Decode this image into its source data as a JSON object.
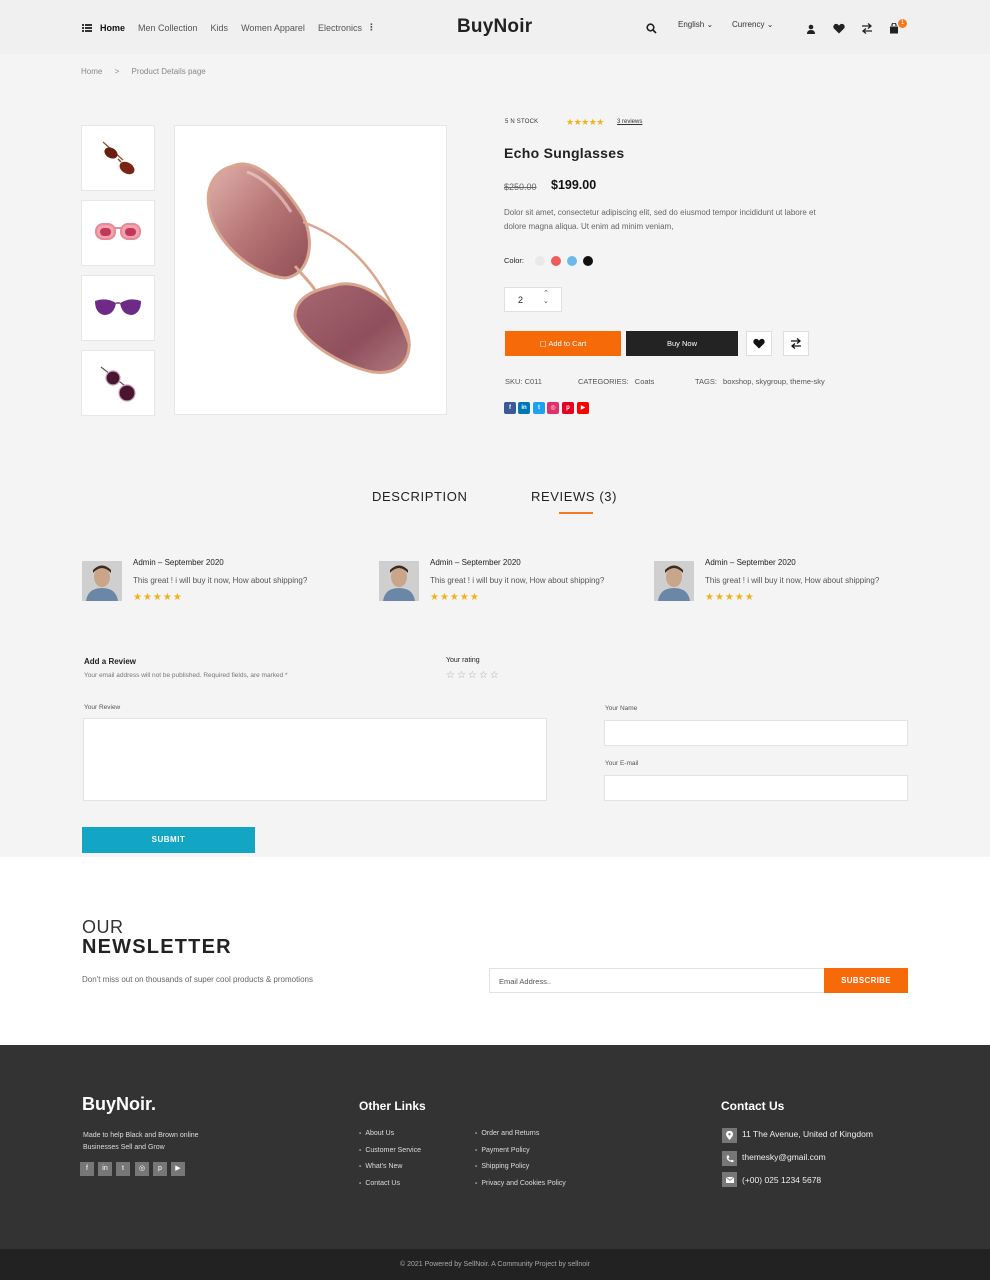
{
  "header": {
    "nav": [
      "Home",
      "Men Collection",
      "Kids",
      "Women Apparel",
      "Electronics"
    ],
    "logo": "BuyNoir",
    "language": "English",
    "currency": "Currency",
    "cart_count": "1"
  },
  "breadcrumb": [
    "Home",
    ">",
    "Product Details page"
  ],
  "product": {
    "stock": "5 N STOCK",
    "reviews_link": "3 reviews",
    "title": "Echo Sunglasses",
    "old_price": "$250.00",
    "price": "$199.00",
    "description": "Dolor sit amet, consectetur adipiscing elit, sed do eiusmod tempor incididunt ut labore et dolore magna aliqua. Ut enim ad minim veniam,",
    "color_label": "Color:",
    "colors": [
      "#e9e9e9",
      "#ef5a5a",
      "#6bb8ec",
      "#111111"
    ],
    "quantity": "2",
    "add_to_cart": "Add to Cart",
    "buy_now": "Buy Now",
    "sku": "SKU: C011",
    "categories_label": "CATEGORIES:",
    "categories": "Coats",
    "tags_label": "TAGS:",
    "tags": "boxshop, skygroup, theme-sky",
    "social": [
      "f",
      "in",
      "t",
      "ig",
      "p",
      "yt"
    ]
  },
  "tabs": {
    "description": "DESCRIPTION",
    "reviews": "REVIEWS (3)"
  },
  "reviews": [
    {
      "author": "Admin – September 2020",
      "text": "This great ! i will buy it now, How about shipping?",
      "rating": 5
    },
    {
      "author": "Admin – September 2020",
      "text": "This great ! i will buy it now, How about shipping?",
      "rating": 5
    },
    {
      "author": "Admin – September 2020",
      "text": "This great ! i will buy it now, How about shipping?",
      "rating": 5
    }
  ],
  "review_form": {
    "title": "Add a Review",
    "note": "Your email address will not be published. Required fields, are marked *",
    "rating_label": "Your rating",
    "review_label": "Your Review",
    "name_label": "Your Name",
    "email_label": "Your E-mail",
    "submit": "SUBMIT"
  },
  "newsletter": {
    "our": "OUR",
    "heading": "NEWSLETTER",
    "subtitle": "Don't miss out on thousands of super cool products & promotions",
    "placeholder": "Email Address..",
    "button": "SUBSCRIBE"
  },
  "footer": {
    "logo": "BuyNoir.",
    "tagline": "Made to help Black and Brown online Businesses Sell and Grow",
    "other_links_title": "Other Links",
    "links_col1": [
      "About Us",
      "Customer Service",
      "What's New",
      "Contact Us"
    ],
    "links_col2": [
      "Order and Returns",
      "Payment Policy",
      "Shipping Policy",
      "Privacy and Cookies Policy"
    ],
    "contact_title": "Contact Us",
    "address": "11 The Avenue, United of Kingdom",
    "email": "themesky@gmail.com",
    "phone": "(+00) 025 1234 5678",
    "copyright": "2021   Powered by SellNoir. A Community Project by sellnoir"
  },
  "colors": {
    "accent": "#f66a0a",
    "submit": "#12a6c4",
    "footer_bg": "#333333",
    "star": "#f2b01e"
  }
}
